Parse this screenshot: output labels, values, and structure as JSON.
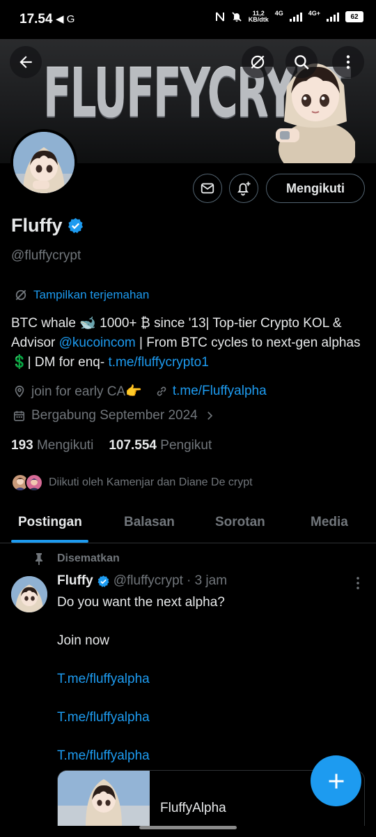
{
  "status_bar": {
    "time": "17.54",
    "left_icons": "◀ G",
    "speed_value": "11,2",
    "speed_unit": "KB/dtk",
    "net1": "4G",
    "net2": "4G+",
    "battery": "62"
  },
  "banner": {
    "text": "FLUFFYCRYPT",
    "icons": [
      "back-arrow-icon",
      "translate-off-icon",
      "search-icon",
      "more-vertical-icon"
    ]
  },
  "profile": {
    "name": "Fluffy",
    "handle": "@fluffycrypt",
    "follow_label": "Mengikuti",
    "translate_label": "Tampilkan terjemahan",
    "bio_1": "BTC whale 🐋 1000+ ₿ since '13| Top-tier Crypto KOL & Advisor ",
    "bio_link_1": "@kucoincom",
    "bio_2": " | From BTC cycles to next-gen alphas 💲| DM for enq- ",
    "bio_link_2": "t.me/fluffycrypto1",
    "location": "join for early CA👉",
    "website": "t.me/Fluffyalpha",
    "joined": "Bergabung September 2024",
    "following_count": "193",
    "following_label": "Mengikuti",
    "followers_count": "107.554",
    "followers_label": "Pengikut",
    "followed_by": "Diikuti oleh Kamenjar dan Diane De crypt"
  },
  "tabs": [
    "Postingan",
    "Balasan",
    "Sorotan",
    "Media"
  ],
  "post": {
    "pinned_label": "Disematkan",
    "author": "Fluffy",
    "handle": "@fluffycrypt",
    "time": "· 3 jam",
    "line1": "Do you want the next alpha?",
    "line2": "Join now",
    "links": [
      "T.me/fluffyalpha",
      "T.me/fluffyalpha",
      "T.me/fluffyalpha"
    ],
    "card_title": "FluffyAlpha"
  },
  "colors": {
    "accent": "#1d9bf0",
    "muted": "#71767b",
    "text": "#e7e9ea",
    "border": "#2f3336"
  }
}
